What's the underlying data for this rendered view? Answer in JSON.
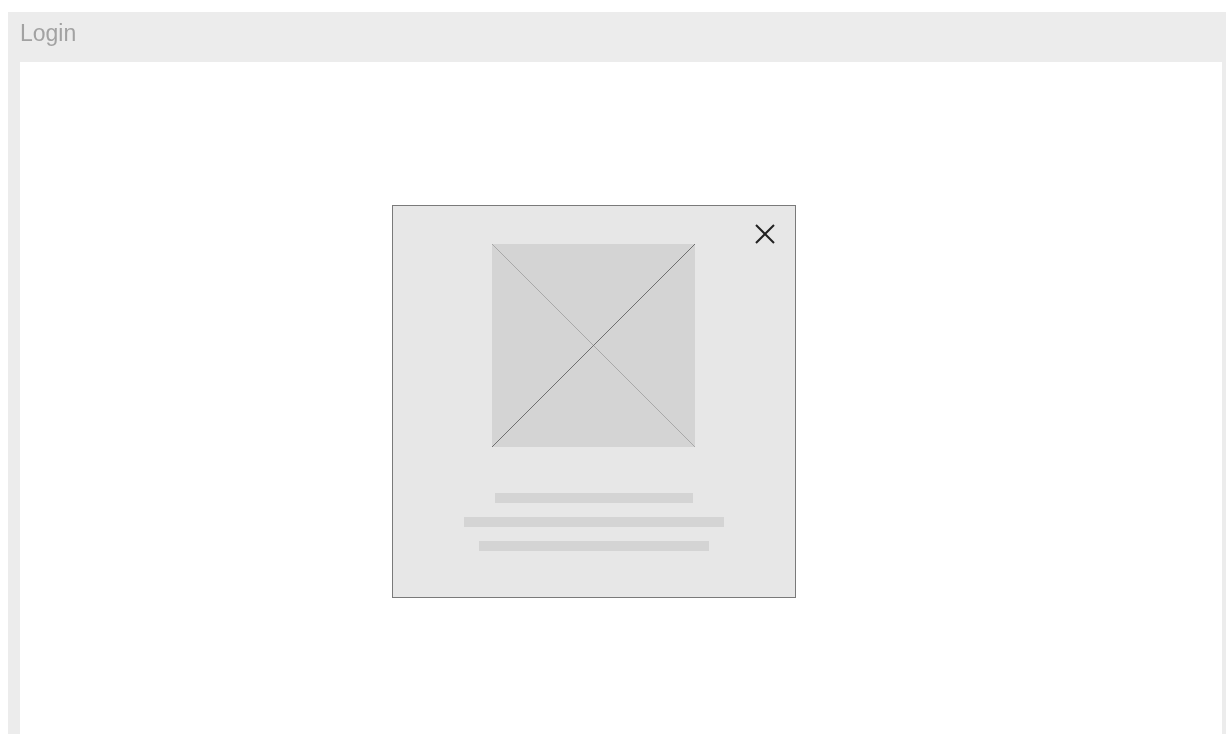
{
  "window": {
    "title": "Login"
  }
}
